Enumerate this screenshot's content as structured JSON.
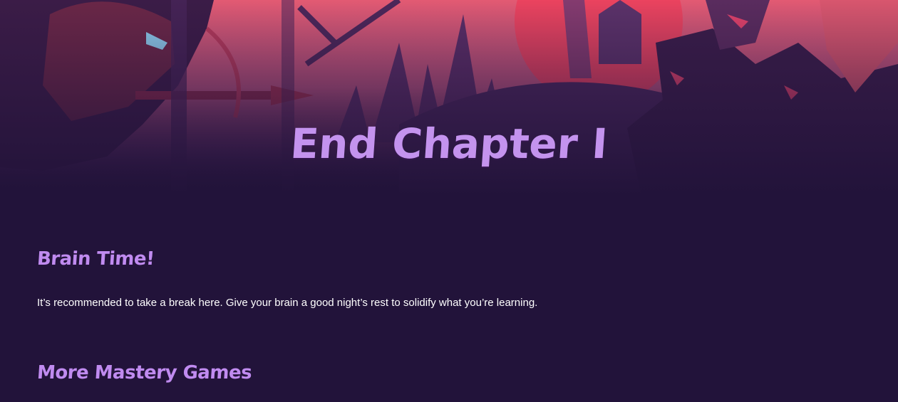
{
  "chapter": {
    "title": "End Chapter I"
  },
  "brain_time": {
    "heading": "Brain Time!",
    "body": "It’s recommended to take a break here. Give your brain a good night’s rest to solidify what you’re learning."
  },
  "mastery_games": {
    "heading": "More Mastery Games"
  },
  "colors": {
    "page_background": "#22133a",
    "heading_accent": "#c08bf0",
    "hero_sky_top": "#e5566e",
    "hero_sky_mid": "#b94a78",
    "hero_silhouette": "#3a1f4d",
    "hero_moon": "#ec3f5c"
  },
  "hero_illustration": "hooded-crossbow-archer-forest-castle-scene"
}
